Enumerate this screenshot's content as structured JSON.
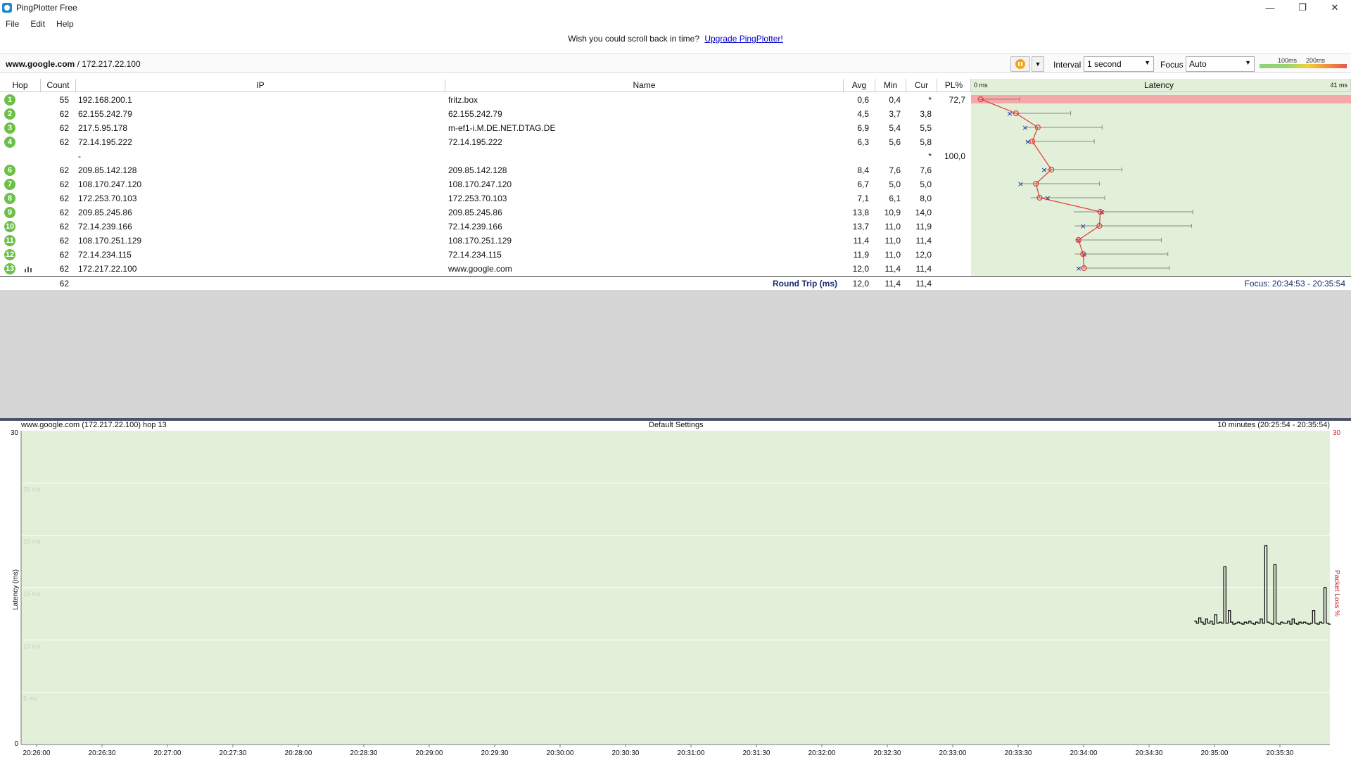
{
  "window": {
    "title": "PingPlotter Free",
    "minimize": "—",
    "maximize": "❐",
    "close": "✕"
  },
  "menu": [
    "File",
    "Edit",
    "Help"
  ],
  "banner": {
    "text": "Wish you could scroll back in time?",
    "link": "Upgrade PingPlotter!"
  },
  "toolbar": {
    "target_host": "www.google.com",
    "target_ip": " / 172.217.22.100",
    "interval_label": "Interval",
    "interval_value": "1 second",
    "focus_label": "Focus",
    "focus_value": "Auto",
    "scale_100": "100ms",
    "scale_200": "200ms"
  },
  "table": {
    "headers": {
      "hop": "Hop",
      "count": "Count",
      "ip": "IP",
      "name": "Name",
      "avg": "Avg",
      "min": "Min",
      "cur": "Cur",
      "pl": "PL%",
      "latency": "Latency"
    },
    "latency_min_label": "0 ms",
    "latency_max_label": "41 ms",
    "rows": [
      {
        "hop": "1",
        "count": "55",
        "ip": "192.168.200.1",
        "name": "fritz.box",
        "avg": "0,6",
        "min": "0,4",
        "cur": "*",
        "pl": "72,7"
      },
      {
        "hop": "2",
        "count": "62",
        "ip": "62.155.242.79",
        "name": "62.155.242.79",
        "avg": "4,5",
        "min": "3,7",
        "cur": "3,8",
        "pl": ""
      },
      {
        "hop": "3",
        "count": "62",
        "ip": "217.5.95.178",
        "name": "m-ef1-i.M.DE.NET.DTAG.DE",
        "avg": "6,9",
        "min": "5,4",
        "cur": "5,5",
        "pl": ""
      },
      {
        "hop": "4",
        "count": "62",
        "ip": "72.14.195.222",
        "name": "72.14.195.222",
        "avg": "6,3",
        "min": "5,6",
        "cur": "5,8",
        "pl": ""
      },
      {
        "hop": "",
        "count": "",
        "ip": "-",
        "name": "",
        "avg": "",
        "min": "",
        "cur": "*",
        "pl": "100,0"
      },
      {
        "hop": "6",
        "count": "62",
        "ip": "209.85.142.128",
        "name": "209.85.142.128",
        "avg": "8,4",
        "min": "7,6",
        "cur": "7,6",
        "pl": ""
      },
      {
        "hop": "7",
        "count": "62",
        "ip": "108.170.247.120",
        "name": "108.170.247.120",
        "avg": "6,7",
        "min": "5,0",
        "cur": "5,0",
        "pl": ""
      },
      {
        "hop": "8",
        "count": "62",
        "ip": "172.253.70.103",
        "name": "172.253.70.103",
        "avg": "7,1",
        "min": "6,1",
        "cur": "8,0",
        "pl": ""
      },
      {
        "hop": "9",
        "count": "62",
        "ip": "209.85.245.86",
        "name": "209.85.245.86",
        "avg": "13,8",
        "min": "10,9",
        "cur": "14,0",
        "pl": ""
      },
      {
        "hop": "10",
        "count": "62",
        "ip": "72.14.239.166",
        "name": "72.14.239.166",
        "avg": "13,7",
        "min": "11,0",
        "cur": "11,9",
        "pl": ""
      },
      {
        "hop": "11",
        "count": "62",
        "ip": "108.170.251.129",
        "name": "108.170.251.129",
        "avg": "11,4",
        "min": "11,0",
        "cur": "11,4",
        "pl": ""
      },
      {
        "hop": "12",
        "count": "62",
        "ip": "72.14.234.115",
        "name": "72.14.234.115",
        "avg": "11,9",
        "min": "11,0",
        "cur": "12,0",
        "pl": ""
      },
      {
        "hop": "13",
        "count": "62",
        "ip": "172.217.22.100",
        "name": "www.google.com",
        "avg": "12,0",
        "min": "11,4",
        "cur": "11,4",
        "pl": ""
      }
    ],
    "round_trip": {
      "count": "62",
      "label": "Round Trip (ms)",
      "avg": "12,0",
      "min": "11,4",
      "cur": "11,4",
      "focus": "Focus: 20:34:53 - 20:35:54"
    }
  },
  "graph": {
    "left_title": "www.google.com (172.217.22.100) hop 13",
    "center_title": "Default Settings",
    "right_title": "10 minutes (20:25:54 - 20:35:54)",
    "y_axis_label": "Latency (ms)",
    "y2_axis_label": "Packet Loss %",
    "y_top": "30",
    "y_bottom": "0",
    "y2_top": "30",
    "y_ticks": [
      "25 ms",
      "20 ms",
      "15 ms",
      "10 ms",
      "5 ms"
    ],
    "x_ticks": [
      "20:26:00",
      "20:26:30",
      "20:27:00",
      "20:27:30",
      "20:28:00",
      "20:28:30",
      "20:29:00",
      "20:29:30",
      "20:30:00",
      "20:30:30",
      "20:31:00",
      "20:31:30",
      "20:32:00",
      "20:32:30",
      "20:33:00",
      "20:33:30",
      "20:34:00",
      "20:34:30",
      "20:35:00",
      "20:35:30"
    ],
    "colors": {
      "background": "#e2f0d9",
      "line": "#000000",
      "latency": "#e53935",
      "jitter": "#1e2aa0"
    }
  }
}
